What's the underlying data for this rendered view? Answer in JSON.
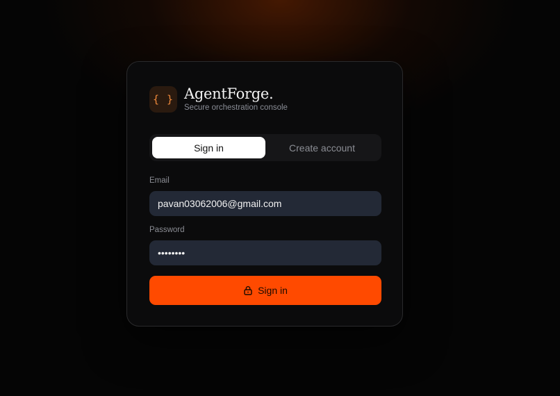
{
  "brand": {
    "mark": "{ }",
    "title": "AgentForge.",
    "subtitle": "Secure orchestration console"
  },
  "tabs": [
    {
      "label": "Sign in",
      "active": true
    },
    {
      "label": "Create account",
      "active": false
    }
  ],
  "form": {
    "email_label": "Email",
    "email_value": "pavan03062006@gmail.com",
    "password_label": "Password",
    "password_value": "password",
    "submit_label": "Sign in",
    "submit_icon": "lock-icon"
  },
  "colors": {
    "accent": "#ff4a00",
    "brand_mark": "#f08a3c",
    "input_bg": "#232936"
  }
}
